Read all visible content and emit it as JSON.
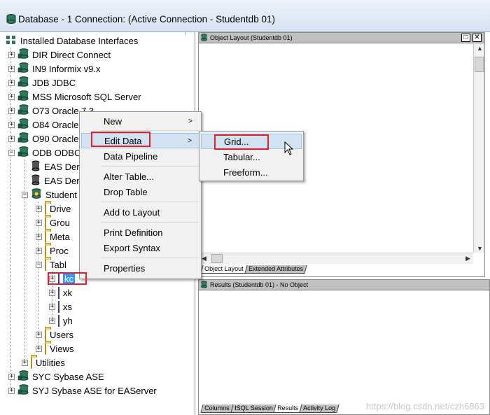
{
  "window": {
    "title": "Database - 1 Connection: (Active Connection - Studentdb 01)"
  },
  "tree": {
    "root_label": "Installed Database Interfaces",
    "items": [
      {
        "label": "DIR Direct Connect"
      },
      {
        "label": "IN9 Informix v9.x"
      },
      {
        "label": "JDB JDBC"
      },
      {
        "label": "MSS Microsoft SQL Server"
      },
      {
        "label": "O73 Oracle 7.3"
      },
      {
        "label": "O84 Oracle"
      },
      {
        "label": "O90 Oracle"
      },
      {
        "label": "ODB ODBC"
      },
      {
        "label": "EAS Der"
      },
      {
        "label": "EAS Der"
      },
      {
        "label": "Student"
      },
      {
        "label": "Drive"
      },
      {
        "label": "Grou"
      },
      {
        "label": "Meta"
      },
      {
        "label": "Proc"
      },
      {
        "label": "Tabl"
      },
      {
        "label": "kc"
      },
      {
        "label": "xk"
      },
      {
        "label": "xs"
      },
      {
        "label": "yh"
      },
      {
        "label": "Users"
      },
      {
        "label": "Views"
      },
      {
        "label": "Utilities"
      },
      {
        "label": "SYC Sybase ASE"
      },
      {
        "label": "SYJ Sybase ASE for EAServer"
      }
    ]
  },
  "object_layout": {
    "title": "Object Layout (Studentdb 01)",
    "tabs": [
      "Object Layout",
      "Extended Attributes"
    ]
  },
  "results": {
    "title": "Results (Studentdb 01) - No Object",
    "tabs": [
      "Columns",
      "ISQL Session",
      "Results",
      "Activity Log"
    ]
  },
  "context_menu": {
    "items": [
      "New",
      "Edit Data",
      "Data Pipeline",
      "Alter Table...",
      "Drop Table",
      "Add to Layout",
      "Print Definition",
      "Export Syntax",
      "Properties"
    ]
  },
  "submenu": {
    "items": [
      "Grid...",
      "Tabular...",
      "Freeform..."
    ]
  },
  "watermark": "https://blog.csdn.net/czh6863",
  "colors": {
    "highlight": "#d1e2f2",
    "annotation": "#e0202a"
  }
}
